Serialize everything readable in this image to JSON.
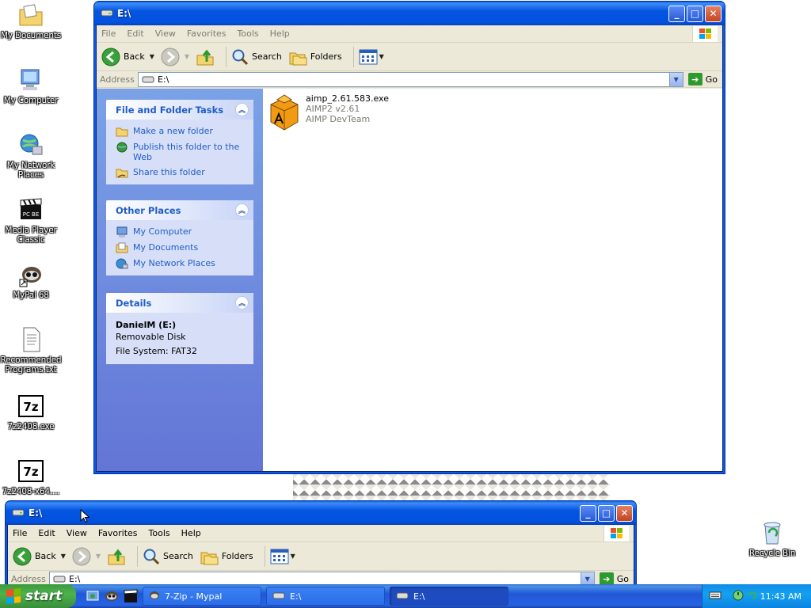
{
  "desktop": {
    "icons": [
      {
        "id": "my-documents",
        "label": "My Documents",
        "icon": "folder-documents-icon"
      },
      {
        "id": "my-computer",
        "label": "My Computer",
        "icon": "computer-icon"
      },
      {
        "id": "my-network-places",
        "label": "My Network Places",
        "icon": "network-globe-icon"
      },
      {
        "id": "media-player-classic",
        "label": "Media Player Classic",
        "icon": "clapperboard-icon"
      },
      {
        "id": "mypal-68",
        "label": "MyPal 68",
        "icon": "raccoon-icon"
      },
      {
        "id": "recommended-programs",
        "label": "Recommended Programs.txt",
        "icon": "text-file-icon"
      },
      {
        "id": "7z2408-exe",
        "label": "7z2408.exe",
        "icon": "7zip-icon"
      },
      {
        "id": "7z2408-x64",
        "label": "7z2408-x64....",
        "icon": "7zip-icon"
      },
      {
        "id": "recycle-bin",
        "label": "Recycle Bin",
        "icon": "recycle-bin-icon"
      }
    ]
  },
  "window_main": {
    "title": "E:\\",
    "menu": [
      "File",
      "Edit",
      "View",
      "Favorites",
      "Tools",
      "Help"
    ],
    "toolbar": {
      "back": "Back",
      "search": "Search",
      "folders": "Folders"
    },
    "address": {
      "label": "Address",
      "value": "E:\\",
      "go": "Go"
    },
    "tasks": {
      "title": "File and Folder Tasks",
      "links": [
        "Make a new folder",
        "Publish this folder to the Web",
        "Share this folder"
      ]
    },
    "other_places": {
      "title": "Other Places",
      "links": [
        "My Computer",
        "My Documents",
        "My Network Places"
      ]
    },
    "details": {
      "title": "Details",
      "name": "DanielM (E:)",
      "type": "Removable Disk",
      "fs": "File System: FAT32"
    },
    "files": [
      {
        "name": "aimp_2.61.583.exe",
        "desc": "AIMP2 v2.61",
        "company": "AIMP DevTeam"
      }
    ]
  },
  "window_second": {
    "title": "E:\\",
    "menu": [
      "File",
      "Edit",
      "View",
      "Favorites",
      "Tools",
      "Help"
    ],
    "toolbar": {
      "back": "Back",
      "search": "Search",
      "folders": "Folders"
    },
    "address": {
      "label": "Address",
      "value": "E:\\",
      "go": "Go"
    }
  },
  "taskbar": {
    "start": "start",
    "tasks": [
      {
        "label": "7-Zip - Mypal",
        "icon": "mypal-icon",
        "active": false
      },
      {
        "label": "E:\\",
        "icon": "drive-icon",
        "active": false
      },
      {
        "label": "E:\\",
        "icon": "drive-icon",
        "active": true
      }
    ],
    "time": "11:43 AM"
  },
  "colors": {
    "xp_blue": "#0454e1",
    "taskpane_link": "#215dc6",
    "start_green": "#3c9a3c"
  }
}
